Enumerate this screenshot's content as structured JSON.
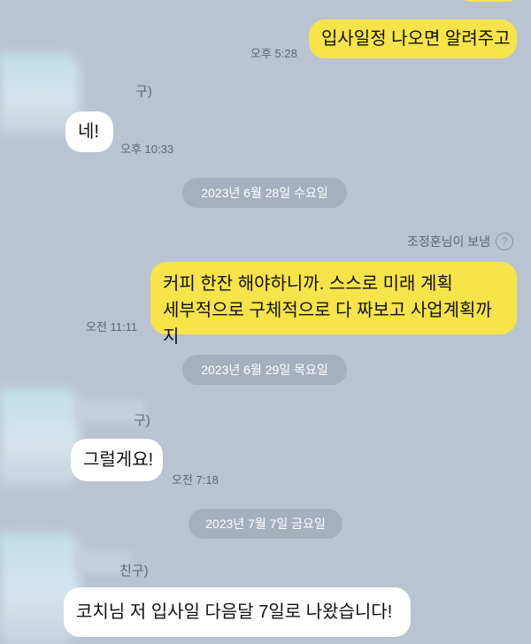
{
  "messages": [
    {
      "text": "입사일정 나오면 알려주고",
      "time": "오후 5:28"
    },
    {
      "text": "네!",
      "time": "오후 10:33",
      "name_tail": "구)"
    },
    {
      "lines": [
        "커피 한잔 해야하니까. 스스로 미래 계획",
        "세부적으로 구체적으로 다 짜보고 사업계획까지"
      ],
      "time": "오전 11:11"
    },
    {
      "text": "그럴게요!",
      "time": "오전 7:18",
      "name_tail": "구)"
    },
    {
      "text": "코치님 저 입사일 다음달 7일로 나왔습니다!",
      "name_tail": "친구)"
    }
  ],
  "dates": [
    "2023년 6월 28일 수요일",
    "2023년 6월 29일 목요일",
    "2023년 7월 7일 금요일"
  ],
  "sender_note": "조정훈님이 보냄",
  "help_glyph": "?",
  "colors": {
    "background": "#b9c3d2",
    "outgoing_bubble": "#f7e34a",
    "incoming_bubble": "#ffffff",
    "date_pill": "#a6afbc"
  },
  "icons": {
    "help": "question-circle-icon"
  }
}
